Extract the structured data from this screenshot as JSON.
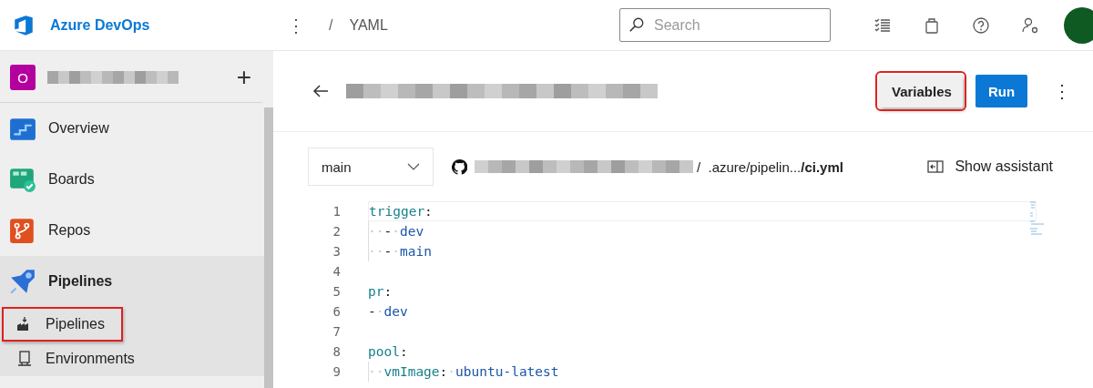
{
  "header": {
    "brand": "Azure DevOps",
    "more": "⋮",
    "separator": "/",
    "crumb": "YAML",
    "search": {
      "placeholder": "Search"
    }
  },
  "sidebar": {
    "project": {
      "initial": "O",
      "add": "+"
    },
    "items": [
      {
        "label": "Overview",
        "kind": "overview",
        "selected": false
      },
      {
        "label": "Boards",
        "kind": "boards",
        "selected": false
      },
      {
        "label": "Repos",
        "kind": "repos",
        "selected": false
      },
      {
        "label": "Pipelines",
        "kind": "pipelines",
        "selected": true,
        "children": [
          {
            "label": "Pipelines",
            "kind": "factory",
            "highlighted": true
          },
          {
            "label": "Environments",
            "kind": "server",
            "highlighted": false
          }
        ]
      }
    ]
  },
  "toolbar": {
    "buttons": [
      {
        "label": "Variables",
        "kind": "secondary",
        "highlighted": true
      },
      {
        "label": "Run",
        "kind": "primary",
        "highlighted": false
      }
    ],
    "more": "⋮"
  },
  "file_bar": {
    "branch": "main",
    "path": "/  .azure/pipelin...",
    "file": "/ci.yml",
    "assistant": "Show assistant"
  },
  "editor": {
    "lines": [
      {
        "number": "1",
        "tokens": [
          {
            "kind": "key",
            "text": "trigger"
          },
          {
            "kind": "punct",
            "text": ":"
          }
        ]
      },
      {
        "number": "2",
        "tokens": [
          {
            "kind": "ws",
            "text": "··"
          },
          {
            "kind": "punct",
            "text": "-"
          },
          {
            "kind": "ws",
            "text": "·"
          },
          {
            "kind": "value",
            "text": "dev"
          }
        ]
      },
      {
        "number": "3",
        "tokens": [
          {
            "kind": "ws",
            "text": "··"
          },
          {
            "kind": "punct",
            "text": "-"
          },
          {
            "kind": "ws",
            "text": "·"
          },
          {
            "kind": "value",
            "text": "main"
          }
        ]
      },
      {
        "number": "4"
      },
      {
        "number": "5",
        "tokens": [
          {
            "kind": "key",
            "text": "pr"
          },
          {
            "kind": "punct",
            "text": ":"
          }
        ]
      },
      {
        "number": "6",
        "tokens": [
          {
            "kind": "punct",
            "text": "-"
          },
          {
            "kind": "ws",
            "text": "·"
          },
          {
            "kind": "value",
            "text": "dev"
          }
        ]
      },
      {
        "number": "7"
      },
      {
        "number": "8",
        "tokens": [
          {
            "kind": "key",
            "text": "pool"
          },
          {
            "kind": "punct",
            "text": ":"
          }
        ]
      },
      {
        "number": "9",
        "tokens": [
          {
            "kind": "ws",
            "text": "··"
          },
          {
            "kind": "key",
            "text": "vmImage"
          },
          {
            "kind": "punct",
            "text": ":"
          },
          {
            "kind": "ws",
            "text": "·"
          },
          {
            "kind": "value",
            "text": "ubuntu-latest"
          }
        ]
      }
    ]
  }
}
